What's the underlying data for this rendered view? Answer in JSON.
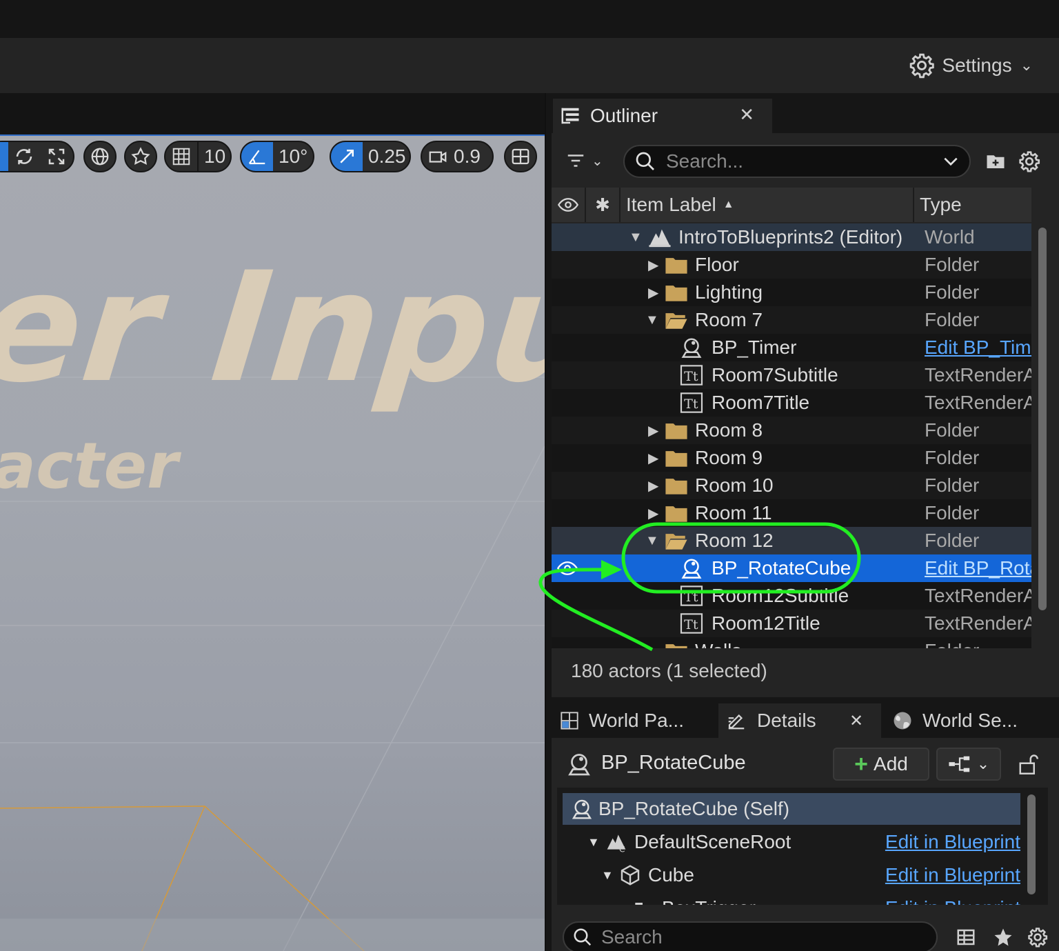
{
  "header": {
    "settings_label": "Settings"
  },
  "viewport": {
    "big_text": "er Input",
    "small_text": "acter",
    "toolbar": {
      "grid_value": "10",
      "angle_value": "10°",
      "scale_value": "0.25",
      "camera_speed": "0.9"
    }
  },
  "outliner": {
    "tab_label": "Outliner",
    "search_placeholder": "Search...",
    "columns": {
      "label": "Item Label",
      "type": "Type"
    },
    "rows": [
      {
        "label": "IntroToBlueprints2 (Editor)",
        "type": "World"
      },
      {
        "label": "Floor",
        "type": "Folder"
      },
      {
        "label": "Lighting",
        "type": "Folder"
      },
      {
        "label": "Room 7",
        "type": "Folder"
      },
      {
        "label": "BP_Timer",
        "type": "Edit BP_Timer"
      },
      {
        "label": "Room7Subtitle",
        "type": "TextRenderActor"
      },
      {
        "label": "Room7Title",
        "type": "TextRenderActor"
      },
      {
        "label": "Room 8",
        "type": "Folder"
      },
      {
        "label": "Room 9",
        "type": "Folder"
      },
      {
        "label": "Room 10",
        "type": "Folder"
      },
      {
        "label": "Room 11",
        "type": "Folder"
      },
      {
        "label": "Room 12",
        "type": "Folder"
      },
      {
        "label": "BP_RotateCube",
        "type": "Edit BP_RotateCube"
      },
      {
        "label": "Room12Subtitle",
        "type": "TextRenderActor"
      },
      {
        "label": "Room12Title",
        "type": "TextRenderActor"
      },
      {
        "label": "Walls",
        "type": "Folder"
      }
    ],
    "status": "180 actors (1 selected)"
  },
  "bottom_tabs": {
    "world_partition": "World Pa...",
    "details": "Details",
    "world_settings": "World Se..."
  },
  "details": {
    "actor_name": "BP_RotateCube",
    "add_label": "Add",
    "components": [
      {
        "label": "BP_RotateCube (Self)",
        "edit": ""
      },
      {
        "label": "DefaultSceneRoot",
        "edit": "Edit in Blueprint"
      },
      {
        "label": "Cube",
        "edit": "Edit in Blueprint"
      },
      {
        "label": "BoxTrigger",
        "edit": "Edit in Blueprint"
      }
    ],
    "search_placeholder": "Search"
  },
  "colors": {
    "accent": "#1466d8",
    "annotation": "#22ee22",
    "link": "#58a6ff",
    "folder": "#c8a25a"
  }
}
